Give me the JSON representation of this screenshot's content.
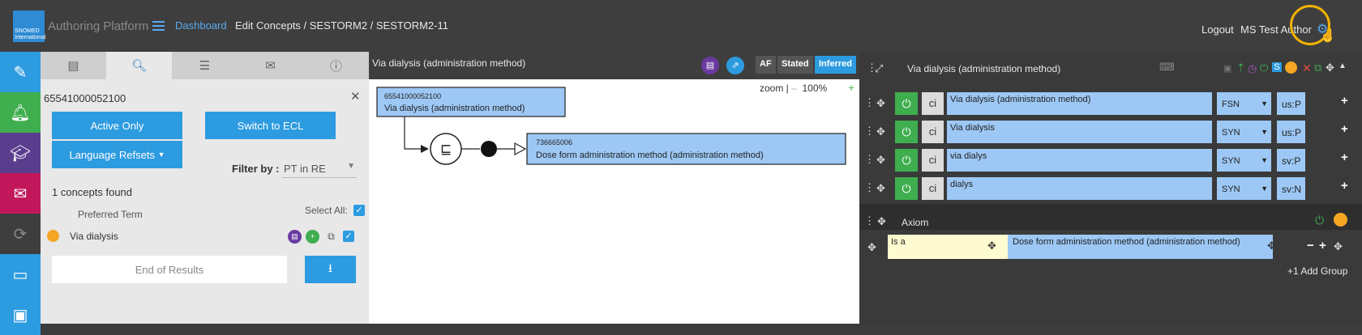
{
  "header": {
    "logo_text": "SNOMED International",
    "app_title": "Authoring Platform",
    "breadcrumb_dashboard": "Dashboard",
    "breadcrumb_path": "Edit Concepts  /  SESTORM2  /  SESTORM2-11",
    "logout": "Logout",
    "user": "MS Test Author",
    "settings_icon": "gear-icon"
  },
  "rail": {
    "items": [
      {
        "icon": "edit-icon",
        "color": "#2d9be0"
      },
      {
        "icon": "bell-icon",
        "color": "#3fae4f"
      },
      {
        "icon": "graduation-cap-icon",
        "color": "#5b3d8e"
      },
      {
        "icon": "envelope-icon",
        "color": "#c2185b"
      },
      {
        "icon": "sync-icon",
        "color": "#3e3e3e"
      },
      {
        "icon": "monitor-icon",
        "color": "#2d9be0"
      },
      {
        "icon": "window-icon",
        "color": "#2d9be0"
      }
    ]
  },
  "search": {
    "tabs": [
      {
        "icon": "taxonomy-icon"
      },
      {
        "icon": "search-icon"
      },
      {
        "icon": "list-icon"
      },
      {
        "icon": "envelope-icon"
      },
      {
        "icon": "info-icon"
      }
    ],
    "query": "65541000052100",
    "active_only": "Active Only",
    "switch_ecl": "Switch to ECL",
    "language_refsets": "Language Refsets",
    "filter_label": "Filter by :",
    "filter_value": "PT in RE",
    "found": "1 concepts found",
    "column_header": "Preferred Term",
    "select_all": "Select All:",
    "result_term": "Via dialysis",
    "end_of_results": "End of Results"
  },
  "diagram": {
    "title": "Via dialysis (administration method)",
    "af": "AF",
    "stated": "Stated",
    "inferred": "Inferred",
    "zoom_label": "zoom |",
    "zoom_minus": "–",
    "zoom_value": "100%",
    "zoom_plus": "+",
    "concept_id": "65541000052100",
    "concept_term": "Via dialysis (administration method)",
    "isa_symbol": "⊑",
    "parent_id": "736665006",
    "parent_term": "Dose form administration method (administration method)"
  },
  "editor": {
    "title": "Via dialysis (administration method)",
    "descriptions": [
      {
        "case": "ci",
        "term": "Via dialysis (administration method)",
        "type": "FSN",
        "lang": "us:P"
      },
      {
        "case": "ci",
        "term": "Via dialysis",
        "type": "SYN",
        "lang": "us:P"
      },
      {
        "case": "ci",
        "term": "via dialys",
        "type": "SYN",
        "lang": "sv:P"
      },
      {
        "case": "ci",
        "term": "dialys",
        "type": "SYN",
        "lang": "sv:N"
      }
    ],
    "axiom_label": "Axiom",
    "attribute_type": "Is a",
    "attribute_value": "Dose form administration method (administration method)",
    "add_group": "+1 Add Group"
  }
}
